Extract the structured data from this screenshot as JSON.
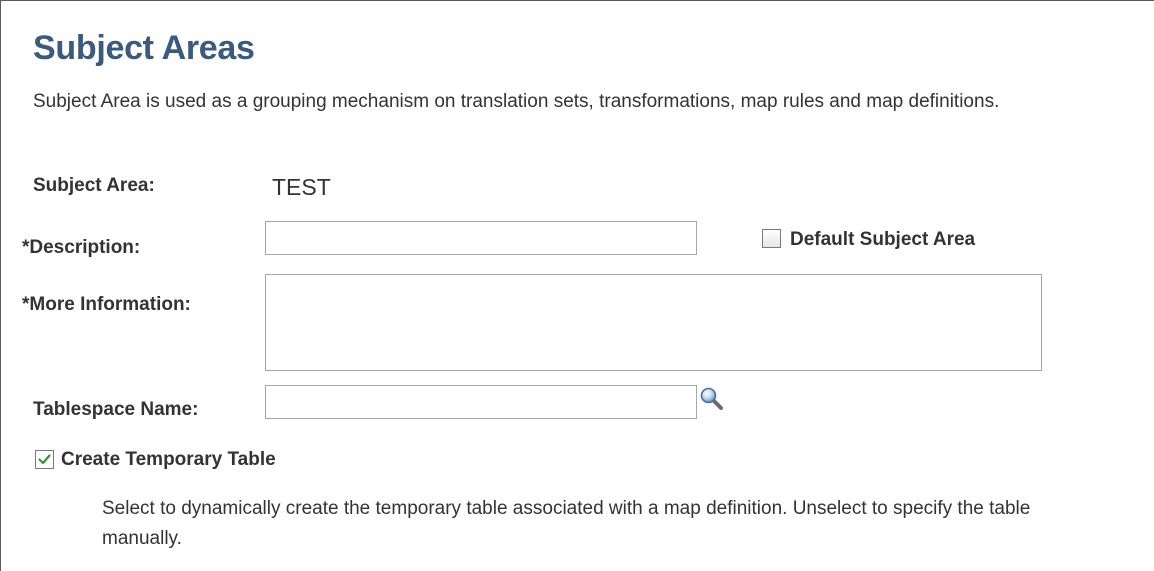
{
  "page": {
    "title": "Subject Areas",
    "description": "Subject Area is used as a grouping mechanism on translation sets, transformations, map rules and map definitions."
  },
  "form": {
    "subject_area_label": "Subject Area:",
    "subject_area_value": "TEST",
    "description_label": "*Description:",
    "description_value": "",
    "default_subject_area_label": "Default Subject Area",
    "default_subject_area_checked": false,
    "more_information_label": "*More Information:",
    "more_information_value": "",
    "tablespace_name_label": "Tablespace Name:",
    "tablespace_name_value": "",
    "create_temp_table_label": "Create Temporary Table",
    "create_temp_table_checked": true,
    "create_temp_table_help": "Select to dynamically create the temporary table associated with a map definition. Unselect to specify the table manually."
  },
  "icons": {
    "lookup": "magnifier-lookup-icon",
    "checkmark": "checkmark-icon"
  },
  "colors": {
    "title": "#3a5a80",
    "text": "#333333",
    "check_green": "#2e9a2e",
    "input_border": "#a8a8a8"
  }
}
